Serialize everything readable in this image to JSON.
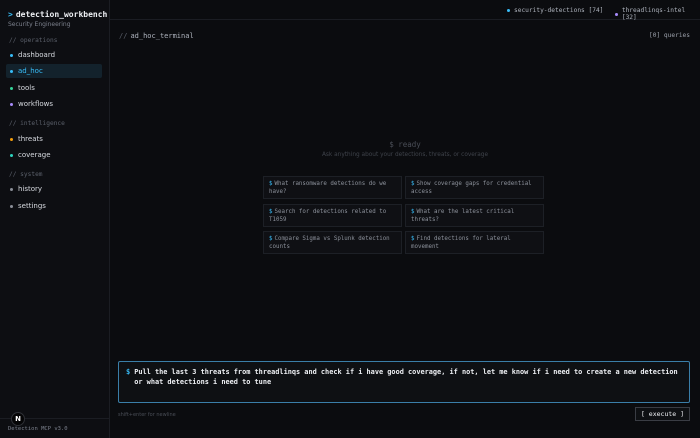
{
  "brand": {
    "caret": ">",
    "title": "detection_workbench",
    "subtitle": "Security Engineering"
  },
  "sidebar": {
    "sections": [
      {
        "label": "// operations"
      },
      {
        "label": "// intelligence"
      },
      {
        "label": "// system"
      }
    ],
    "items": [
      {
        "label": "dashboard",
        "dot_color": "#38bdf8",
        "active": false
      },
      {
        "label": "ad_hoc",
        "dot_color": "#38bdf8",
        "active": true
      },
      {
        "label": "tools",
        "dot_color": "#34d399",
        "active": false
      },
      {
        "label": "workflows",
        "dot_color": "#a78bfa",
        "active": false
      },
      {
        "label": "threats",
        "dot_color": "#f59e0b",
        "active": false
      },
      {
        "label": "coverage",
        "dot_color": "#2dd4bf",
        "active": false
      },
      {
        "label": "history",
        "dot_color": "#8b8f98",
        "active": false
      },
      {
        "label": "settings",
        "dot_color": "#8b8f98",
        "active": false
      }
    ],
    "footer": "Detection MCP v3.0",
    "logo": "N"
  },
  "topbar": {
    "stats": [
      {
        "label": "security-detections [74]",
        "dot_color": "#38bdf8"
      },
      {
        "label": "threadlinqs-intel [32]",
        "dot_color": "#a78bfa"
      }
    ]
  },
  "terminal": {
    "title_prefix": "//",
    "title": "ad_hoc_terminal",
    "queries": "[0] queries",
    "ready": "$ ready",
    "ready_sub": "Ask anything about your detections, threats, or coverage",
    "suggestions": [
      "What ransomware detections do we have?",
      "Show coverage gaps for credential access",
      "Search for detections related to T1059",
      "What are the latest critical threats?",
      "Compare Sigma vs Splunk detection counts",
      "Find detections for lateral movement"
    ]
  },
  "prompt": {
    "symbol": "$",
    "value": "Pull the last 3 threats from threadlinqs and check if i have good coverage, if not, let me know if i need to create a new detection or what detections i need to tune",
    "hint": "shift+enter for newline",
    "execute_label": "[ execute ]"
  },
  "colors": {
    "accent": "#38bdf8",
    "background": "#0b0c0f",
    "prompt_border": "#3a7ea8"
  }
}
